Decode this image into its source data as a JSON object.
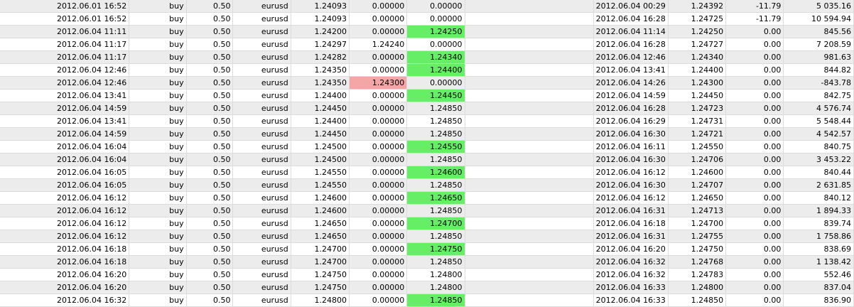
{
  "colors": {
    "stop_loss_hit": "#f4a6a6",
    "take_profit_hit": "#66ee66",
    "row_alt": "#ececec",
    "grid_line": "#dcdcdc"
  },
  "rows": [
    {
      "open_time": "2012.06.01 16:52",
      "type": "buy",
      "volume": "0.50",
      "symbol": "eurusd",
      "price": "1.24093",
      "sl": "0.00000",
      "tp": "0.00000",
      "close_time": "2012.06.04 00:29",
      "close_price": "1.24392",
      "swap": "-11.79",
      "profit": "5 035.16",
      "highlight": ""
    },
    {
      "open_time": "2012.06.01 16:52",
      "type": "buy",
      "volume": "0.50",
      "symbol": "eurusd",
      "price": "1.24093",
      "sl": "0.00000",
      "tp": "0.00000",
      "close_time": "2012.06.04 16:28",
      "close_price": "1.24725",
      "swap": "-11.79",
      "profit": "10 594.94",
      "highlight": ""
    },
    {
      "open_time": "2012.06.04 11:11",
      "type": "buy",
      "volume": "0.50",
      "symbol": "eurusd",
      "price": "1.24200",
      "sl": "0.00000",
      "tp": "1.24250",
      "close_time": "2012.06.04 11:14",
      "close_price": "1.24250",
      "swap": "0.00",
      "profit": "845.56",
      "highlight": "tp"
    },
    {
      "open_time": "2012.06.04 11:17",
      "type": "buy",
      "volume": "0.50",
      "symbol": "eurusd",
      "price": "1.24297",
      "sl": "1.24240",
      "tp": "0.00000",
      "close_time": "2012.06.04 16:28",
      "close_price": "1.24727",
      "swap": "0.00",
      "profit": "7 208.59",
      "highlight": ""
    },
    {
      "open_time": "2012.06.04 11:17",
      "type": "buy",
      "volume": "0.50",
      "symbol": "eurusd",
      "price": "1.24282",
      "sl": "0.00000",
      "tp": "1.24340",
      "close_time": "2012.06.04 12:46",
      "close_price": "1.24340",
      "swap": "0.00",
      "profit": "981.63",
      "highlight": "tp"
    },
    {
      "open_time": "2012.06.04 12:46",
      "type": "buy",
      "volume": "0.50",
      "symbol": "eurusd",
      "price": "1.24350",
      "sl": "0.00000",
      "tp": "1.24400",
      "close_time": "2012.06.04 13:41",
      "close_price": "1.24400",
      "swap": "0.00",
      "profit": "844.82",
      "highlight": "tp"
    },
    {
      "open_time": "2012.06.04 12:46",
      "type": "buy",
      "volume": "0.50",
      "symbol": "eurusd",
      "price": "1.24350",
      "sl": "1.24300",
      "tp": "0.00000",
      "close_time": "2012.06.04 14:26",
      "close_price": "1.24300",
      "swap": "0.00",
      "profit": "-843.78",
      "highlight": "sl"
    },
    {
      "open_time": "2012.06.04 13:41",
      "type": "buy",
      "volume": "0.50",
      "symbol": "eurusd",
      "price": "1.24400",
      "sl": "0.00000",
      "tp": "1.24450",
      "close_time": "2012.06.04 14:59",
      "close_price": "1.24450",
      "swap": "0.00",
      "profit": "842.75",
      "highlight": "tp"
    },
    {
      "open_time": "2012.06.04 14:59",
      "type": "buy",
      "volume": "0.50",
      "symbol": "eurusd",
      "price": "1.24450",
      "sl": "0.00000",
      "tp": "1.24850",
      "close_time": "2012.06.04 16:28",
      "close_price": "1.24723",
      "swap": "0.00",
      "profit": "4 576.74",
      "highlight": ""
    },
    {
      "open_time": "2012.06.04 13:41",
      "type": "buy",
      "volume": "0.50",
      "symbol": "eurusd",
      "price": "1.24400",
      "sl": "0.00000",
      "tp": "1.24850",
      "close_time": "2012.06.04 16:29",
      "close_price": "1.24731",
      "swap": "0.00",
      "profit": "5 548.44",
      "highlight": ""
    },
    {
      "open_time": "2012.06.04 14:59",
      "type": "buy",
      "volume": "0.50",
      "symbol": "eurusd",
      "price": "1.24450",
      "sl": "0.00000",
      "tp": "1.24850",
      "close_time": "2012.06.04 16:30",
      "close_price": "1.24721",
      "swap": "0.00",
      "profit": "4 542.57",
      "highlight": ""
    },
    {
      "open_time": "2012.06.04 16:04",
      "type": "buy",
      "volume": "0.50",
      "symbol": "eurusd",
      "price": "1.24500",
      "sl": "0.00000",
      "tp": "1.24550",
      "close_time": "2012.06.04 16:11",
      "close_price": "1.24550",
      "swap": "0.00",
      "profit": "840.75",
      "highlight": "tp"
    },
    {
      "open_time": "2012.06.04 16:04",
      "type": "buy",
      "volume": "0.50",
      "symbol": "eurusd",
      "price": "1.24500",
      "sl": "0.00000",
      "tp": "1.24850",
      "close_time": "2012.06.04 16:30",
      "close_price": "1.24706",
      "swap": "0.00",
      "profit": "3 453.22",
      "highlight": ""
    },
    {
      "open_time": "2012.06.04 16:05",
      "type": "buy",
      "volume": "0.50",
      "symbol": "eurusd",
      "price": "1.24550",
      "sl": "0.00000",
      "tp": "1.24600",
      "close_time": "2012.06.04 16:12",
      "close_price": "1.24600",
      "swap": "0.00",
      "profit": "840.44",
      "highlight": "tp"
    },
    {
      "open_time": "2012.06.04 16:05",
      "type": "buy",
      "volume": "0.50",
      "symbol": "eurusd",
      "price": "1.24550",
      "sl": "0.00000",
      "tp": "1.24850",
      "close_time": "2012.06.04 16:30",
      "close_price": "1.24707",
      "swap": "0.00",
      "profit": "2 631.85",
      "highlight": ""
    },
    {
      "open_time": "2012.06.04 16:12",
      "type": "buy",
      "volume": "0.50",
      "symbol": "eurusd",
      "price": "1.24600",
      "sl": "0.00000",
      "tp": "1.24650",
      "close_time": "2012.06.04 16:12",
      "close_price": "1.24650",
      "swap": "0.00",
      "profit": "840.12",
      "highlight": "tp"
    },
    {
      "open_time": "2012.06.04 16:12",
      "type": "buy",
      "volume": "0.50",
      "symbol": "eurusd",
      "price": "1.24600",
      "sl": "0.00000",
      "tp": "1.24850",
      "close_time": "2012.06.04 16:31",
      "close_price": "1.24713",
      "swap": "0.00",
      "profit": "1 894.33",
      "highlight": ""
    },
    {
      "open_time": "2012.06.04 16:12",
      "type": "buy",
      "volume": "0.50",
      "symbol": "eurusd",
      "price": "1.24650",
      "sl": "0.00000",
      "tp": "1.24700",
      "close_time": "2012.06.04 16:18",
      "close_price": "1.24700",
      "swap": "0.00",
      "profit": "839.74",
      "highlight": "tp"
    },
    {
      "open_time": "2012.06.04 16:12",
      "type": "buy",
      "volume": "0.50",
      "symbol": "eurusd",
      "price": "1.24650",
      "sl": "0.00000",
      "tp": "1.24850",
      "close_time": "2012.06.04 16:31",
      "close_price": "1.24755",
      "swap": "0.00",
      "profit": "1 758.86",
      "highlight": ""
    },
    {
      "open_time": "2012.06.04 16:18",
      "type": "buy",
      "volume": "0.50",
      "symbol": "eurusd",
      "price": "1.24700",
      "sl": "0.00000",
      "tp": "1.24750",
      "close_time": "2012.06.04 16:20",
      "close_price": "1.24750",
      "swap": "0.00",
      "profit": "838.69",
      "highlight": "tp"
    },
    {
      "open_time": "2012.06.04 16:18",
      "type": "buy",
      "volume": "0.50",
      "symbol": "eurusd",
      "price": "1.24700",
      "sl": "0.00000",
      "tp": "1.24850",
      "close_time": "2012.06.04 16:32",
      "close_price": "1.24768",
      "swap": "0.00",
      "profit": "1 138.42",
      "highlight": ""
    },
    {
      "open_time": "2012.06.04 16:20",
      "type": "buy",
      "volume": "0.50",
      "symbol": "eurusd",
      "price": "1.24750",
      "sl": "0.00000",
      "tp": "1.24800",
      "close_time": "2012.06.04 16:32",
      "close_price": "1.24783",
      "swap": "0.00",
      "profit": "552.46",
      "highlight": ""
    },
    {
      "open_time": "2012.06.04 16:20",
      "type": "buy",
      "volume": "0.50",
      "symbol": "eurusd",
      "price": "1.24750",
      "sl": "0.00000",
      "tp": "1.24800",
      "close_time": "2012.06.04 16:33",
      "close_price": "1.24800",
      "swap": "0.00",
      "profit": "837.04",
      "highlight": ""
    },
    {
      "open_time": "2012.06.04 16:32",
      "type": "buy",
      "volume": "0.50",
      "symbol": "eurusd",
      "price": "1.24800",
      "sl": "0.00000",
      "tp": "1.24850",
      "close_time": "2012.06.04 16:33",
      "close_price": "1.24850",
      "swap": "0.00",
      "profit": "836.90",
      "highlight": "tp"
    }
  ]
}
